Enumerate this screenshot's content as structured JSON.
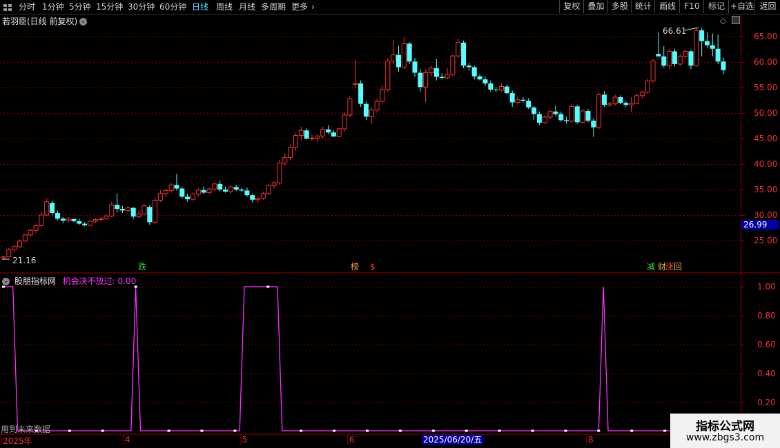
{
  "toolbar": {
    "periods": [
      "分时",
      "1分钟",
      "5分钟",
      "15分钟",
      "30分钟",
      "60分钟",
      "日线",
      "周线",
      "月线",
      "多周期",
      "更多"
    ],
    "active_period": "日线",
    "buttons": [
      "复权",
      "叠加",
      "多股",
      "统计",
      "画线",
      "F10",
      "标记",
      "+自选",
      "返回"
    ]
  },
  "stock": {
    "title": "若羽臣(日线 前复权)",
    "high_label": "66.61",
    "low_label": "21.16",
    "current_price": "26.99"
  },
  "price_axis": [
    "65.00",
    "60.00",
    "55.00",
    "50.00",
    "45.00",
    "40.00",
    "35.00",
    "30.00",
    "25.00"
  ],
  "signals": [
    {
      "text": "跌",
      "color": "#33dd33"
    },
    {
      "text": "榜",
      "color": "#ff9933"
    },
    {
      "text": "$",
      "color": "#ff3333"
    },
    {
      "text": "减",
      "color": "#33dd33"
    },
    {
      "text": "财",
      "color": "#ddbb33"
    },
    {
      "text": "涨",
      "color": "#ff4444"
    },
    {
      "text": "回",
      "color": "#ddbb33"
    }
  ],
  "indicator": {
    "name": "股朋指标网",
    "line_label": "机会决不放过: 0.00",
    "line_color": "#ff33ff",
    "axis": [
      "1.00",
      "0.80",
      "0.60",
      "0.40",
      "0.20"
    ],
    "future_note": "用到未来数据"
  },
  "time_axis": {
    "labels": [
      "2025年",
      "4",
      "5",
      "6",
      "8"
    ],
    "cursor_date": "2025/06/20/五"
  },
  "watermark": {
    "line1": "指标公式网",
    "line2": "www.zbgs3.com"
  },
  "colors": {
    "up": "#ff3333",
    "down": "#54ffff",
    "indicator": "#ff33ff",
    "grid": "#8b0000",
    "axis_line": "#a00000"
  },
  "chart_data": {
    "type": "candlestick",
    "ylim": [
      21,
      67
    ],
    "candles": [
      [
        21.6,
        22.0,
        21.2,
        21.8
      ],
      [
        21.8,
        23.5,
        21.7,
        23.2
      ],
      [
        23.2,
        24.1,
        22.8,
        23.8
      ],
      [
        23.8,
        25.2,
        23.6,
        24.9
      ],
      [
        24.9,
        26.4,
        24.7,
        26.1
      ],
      [
        26.1,
        27.3,
        25.8,
        27.0
      ],
      [
        27.0,
        28.2,
        26.5,
        27.9
      ],
      [
        27.9,
        30.5,
        27.5,
        30.0
      ],
      [
        30.0,
        33.2,
        29.8,
        32.6
      ],
      [
        32.4,
        32.8,
        30.0,
        30.4
      ],
      [
        30.4,
        30.9,
        29.0,
        29.3
      ],
      [
        29.3,
        29.6,
        28.4,
        28.9
      ],
      [
        28.9,
        29.6,
        28.5,
        29.2
      ],
      [
        29.2,
        29.4,
        28.6,
        28.8
      ],
      [
        28.8,
        29.3,
        28.1,
        28.3
      ],
      [
        28.3,
        28.6,
        27.8,
        28.0
      ],
      [
        28.0,
        29.0,
        27.8,
        28.8
      ],
      [
        28.8,
        29.4,
        28.4,
        29.1
      ],
      [
        29.1,
        29.6,
        28.8,
        29.3
      ],
      [
        29.3,
        30.1,
        29.0,
        29.8
      ],
      [
        29.8,
        32.6,
        29.6,
        32.0
      ],
      [
        32.0,
        34.2,
        30.5,
        31.2
      ],
      [
        31.2,
        31.8,
        30.4,
        30.9
      ],
      [
        30.9,
        31.7,
        30.5,
        31.4
      ],
      [
        31.4,
        31.6,
        29.2,
        29.7
      ],
      [
        29.7,
        30.9,
        29.4,
        30.2
      ],
      [
        30.2,
        32.1,
        30.0,
        31.8
      ],
      [
        31.6,
        31.9,
        28.1,
        28.6
      ],
      [
        28.6,
        33.4,
        28.2,
        32.9
      ],
      [
        32.9,
        34.9,
        32.6,
        34.2
      ],
      [
        34.2,
        35.1,
        33.6,
        34.8
      ],
      [
        34.8,
        36.3,
        34.4,
        35.9
      ],
      [
        35.9,
        38.1,
        34.8,
        35.2
      ],
      [
        35.2,
        35.6,
        33.2,
        33.6
      ],
      [
        33.6,
        34.2,
        32.6,
        33.1
      ],
      [
        33.1,
        34.4,
        32.8,
        34.1
      ],
      [
        34.1,
        35.2,
        33.6,
        34.9
      ],
      [
        34.9,
        35.6,
        34.1,
        34.4
      ],
      [
        34.4,
        35.4,
        34.1,
        35.1
      ],
      [
        35.1,
        36.3,
        34.8,
        36.1
      ],
      [
        36.1,
        36.8,
        34.6,
        35.0
      ],
      [
        35.0,
        35.6,
        34.4,
        34.6
      ],
      [
        34.6,
        35.9,
        34.2,
        35.5
      ],
      [
        35.5,
        35.9,
        34.7,
        35.0
      ],
      [
        35.0,
        35.3,
        34.5,
        34.8
      ],
      [
        34.8,
        35.4,
        33.6,
        33.9
      ],
      [
        33.9,
        34.2,
        32.4,
        33.0
      ],
      [
        33.0,
        33.7,
        32.4,
        33.3
      ],
      [
        33.3,
        34.6,
        33.0,
        34.2
      ],
      [
        34.2,
        36.1,
        33.9,
        35.8
      ],
      [
        35.8,
        36.6,
        35.2,
        36.3
      ],
      [
        36.3,
        40.8,
        36.0,
        40.2
      ],
      [
        40.2,
        42.1,
        39.6,
        41.3
      ],
      [
        41.3,
        43.8,
        40.7,
        43.3
      ],
      [
        43.3,
        46.1,
        42.6,
        45.6
      ],
      [
        45.6,
        47.3,
        44.6,
        46.6
      ],
      [
        46.6,
        47.1,
        44.8,
        45.0
      ],
      [
        45.0,
        45.8,
        44.6,
        45.1
      ],
      [
        45.1,
        45.8,
        44.3,
        45.5
      ],
      [
        45.5,
        47.3,
        44.9,
        46.8
      ],
      [
        46.8,
        47.6,
        45.9,
        46.2
      ],
      [
        46.2,
        46.6,
        45.3,
        45.4
      ],
      [
        45.4,
        47.1,
        45.2,
        46.9
      ],
      [
        46.9,
        50.2,
        46.4,
        49.6
      ],
      [
        49.6,
        53.4,
        49.2,
        52.8
      ],
      [
        55.6,
        60.4,
        54.8,
        55.8
      ],
      [
        55.8,
        56.4,
        51.2,
        51.8
      ],
      [
        51.8,
        52.3,
        48.6,
        49.3
      ],
      [
        49.3,
        51.2,
        47.9,
        50.6
      ],
      [
        50.6,
        52.8,
        50.1,
        52.3
      ],
      [
        52.3,
        55.3,
        52.0,
        54.6
      ],
      [
        54.6,
        60.8,
        54.2,
        60.2
      ],
      [
        60.2,
        64.3,
        59.6,
        61.4
      ],
      [
        61.4,
        63.2,
        58.1,
        59.0
      ],
      [
        59.0,
        64.9,
        58.6,
        63.6
      ],
      [
        63.6,
        63.9,
        59.6,
        60.1
      ],
      [
        60.1,
        60.8,
        57.1,
        57.9
      ],
      [
        57.9,
        58.6,
        54.2,
        55.1
      ],
      [
        55.1,
        58.6,
        52.1,
        57.9
      ],
      [
        57.9,
        59.4,
        57.2,
        58.8
      ],
      [
        58.8,
        60.6,
        56.4,
        57.1
      ],
      [
        57.1,
        57.8,
        56.6,
        56.9
      ],
      [
        56.9,
        58.8,
        56.6,
        57.6
      ],
      [
        57.6,
        61.4,
        57.2,
        61.2
      ],
      [
        61.2,
        64.6,
        60.8,
        63.8
      ],
      [
        63.8,
        64.2,
        58.8,
        59.3
      ],
      [
        59.3,
        59.8,
        58.3,
        59.0
      ],
      [
        59.0,
        59.3,
        56.6,
        57.2
      ],
      [
        57.2,
        57.6,
        56.4,
        56.6
      ],
      [
        56.6,
        57.2,
        55.3,
        55.8
      ],
      [
        55.8,
        56.4,
        54.2,
        54.6
      ],
      [
        54.6,
        55.1,
        54.1,
        54.5
      ],
      [
        54.5,
        55.8,
        54.2,
        55.2
      ],
      [
        55.2,
        55.6,
        53.6,
        53.9
      ],
      [
        53.9,
        54.4,
        51.2,
        52.1
      ],
      [
        52.1,
        53.2,
        51.8,
        52.6
      ],
      [
        52.6,
        53.1,
        52.1,
        52.4
      ],
      [
        52.4,
        52.9,
        50.8,
        51.1
      ],
      [
        51.1,
        51.4,
        48.6,
        49.8
      ],
      [
        49.8,
        50.3,
        47.6,
        48.1
      ],
      [
        48.1,
        49.6,
        47.9,
        49.2
      ],
      [
        49.2,
        50.6,
        48.8,
        50.3
      ],
      [
        50.3,
        51.5,
        49.4,
        49.8
      ],
      [
        49.8,
        50.3,
        48.3,
        48.6
      ],
      [
        48.6,
        49.3,
        47.9,
        48.4
      ],
      [
        48.4,
        51.8,
        48.1,
        51.3
      ],
      [
        51.3,
        51.6,
        47.9,
        48.2
      ],
      [
        48.2,
        50.8,
        48.0,
        50.4
      ],
      [
        50.4,
        50.8,
        48.2,
        48.5
      ],
      [
        48.5,
        48.9,
        45.3,
        47.2
      ],
      [
        47.2,
        54.1,
        46.8,
        53.6
      ],
      [
        53.6,
        54.3,
        51.2,
        51.6
      ],
      [
        51.6,
        52.2,
        51.1,
        51.8
      ],
      [
        51.8,
        53.6,
        51.5,
        53.1
      ],
      [
        53.1,
        53.5,
        51.7,
        52.0
      ],
      [
        52.0,
        52.3,
        51.2,
        51.6
      ],
      [
        51.6,
        53.2,
        50.2,
        51.9
      ],
      [
        51.9,
        53.8,
        51.7,
        53.4
      ],
      [
        53.4,
        54.4,
        52.8,
        54.1
      ],
      [
        54.1,
        56.7,
        53.8,
        56.3
      ],
      [
        56.3,
        60.6,
        55.9,
        60.2
      ],
      [
        61.6,
        65.8,
        61.1,
        61.1
      ],
      [
        61.1,
        63.1,
        58.9,
        59.3
      ],
      [
        59.3,
        62.6,
        58.6,
        62.1
      ],
      [
        62.1,
        62.6,
        59.1,
        59.6
      ],
      [
        59.6,
        61.6,
        59.3,
        61.1
      ],
      [
        61.1,
        62.4,
        60.6,
        62.1
      ],
      [
        62.1,
        62.4,
        58.6,
        59.3
      ],
      [
        59.3,
        66.61,
        59.1,
        66.2
      ],
      [
        66.2,
        66.6,
        61.1,
        64.1
      ],
      [
        64.1,
        65.8,
        62.8,
        63.3
      ],
      [
        63.3,
        65.6,
        61.1,
        62.6
      ],
      [
        62.6,
        65.4,
        59.6,
        60.1
      ],
      [
        60.1,
        60.9,
        57.6,
        58.4
      ]
    ],
    "signal_series": [
      1,
      1,
      1,
      0,
      0,
      0,
      0,
      0,
      0,
      0,
      0,
      0,
      0,
      0,
      0,
      0,
      0,
      0,
      0,
      0,
      0,
      0,
      0,
      0,
      0,
      0,
      0,
      0,
      1,
      0,
      0,
      0,
      0,
      0,
      0,
      0,
      0,
      0,
      0,
      0,
      0,
      0,
      0,
      0,
      0,
      0,
      0,
      0,
      0,
      0,
      0,
      1,
      1,
      1,
      1,
      1,
      1,
      1,
      1,
      0,
      0,
      0,
      0,
      0,
      0,
      0,
      0,
      0,
      0,
      0,
      0,
      0,
      0,
      0,
      0,
      0,
      0,
      0,
      0,
      0,
      0,
      0,
      0,
      0,
      0,
      0,
      0,
      0,
      0,
      0,
      0,
      0,
      0,
      0,
      0,
      0,
      0,
      0,
      0,
      0,
      0,
      0,
      0,
      0,
      0,
      0,
      0,
      0,
      0,
      0,
      0,
      0,
      0,
      0,
      0,
      0,
      0,
      0,
      0,
      0,
      0,
      0,
      0,
      0,
      0,
      0,
      0,
      1,
      0,
      0,
      0,
      0,
      0,
      0,
      0,
      0,
      0,
      0,
      0,
      0,
      0,
      0
    ]
  }
}
